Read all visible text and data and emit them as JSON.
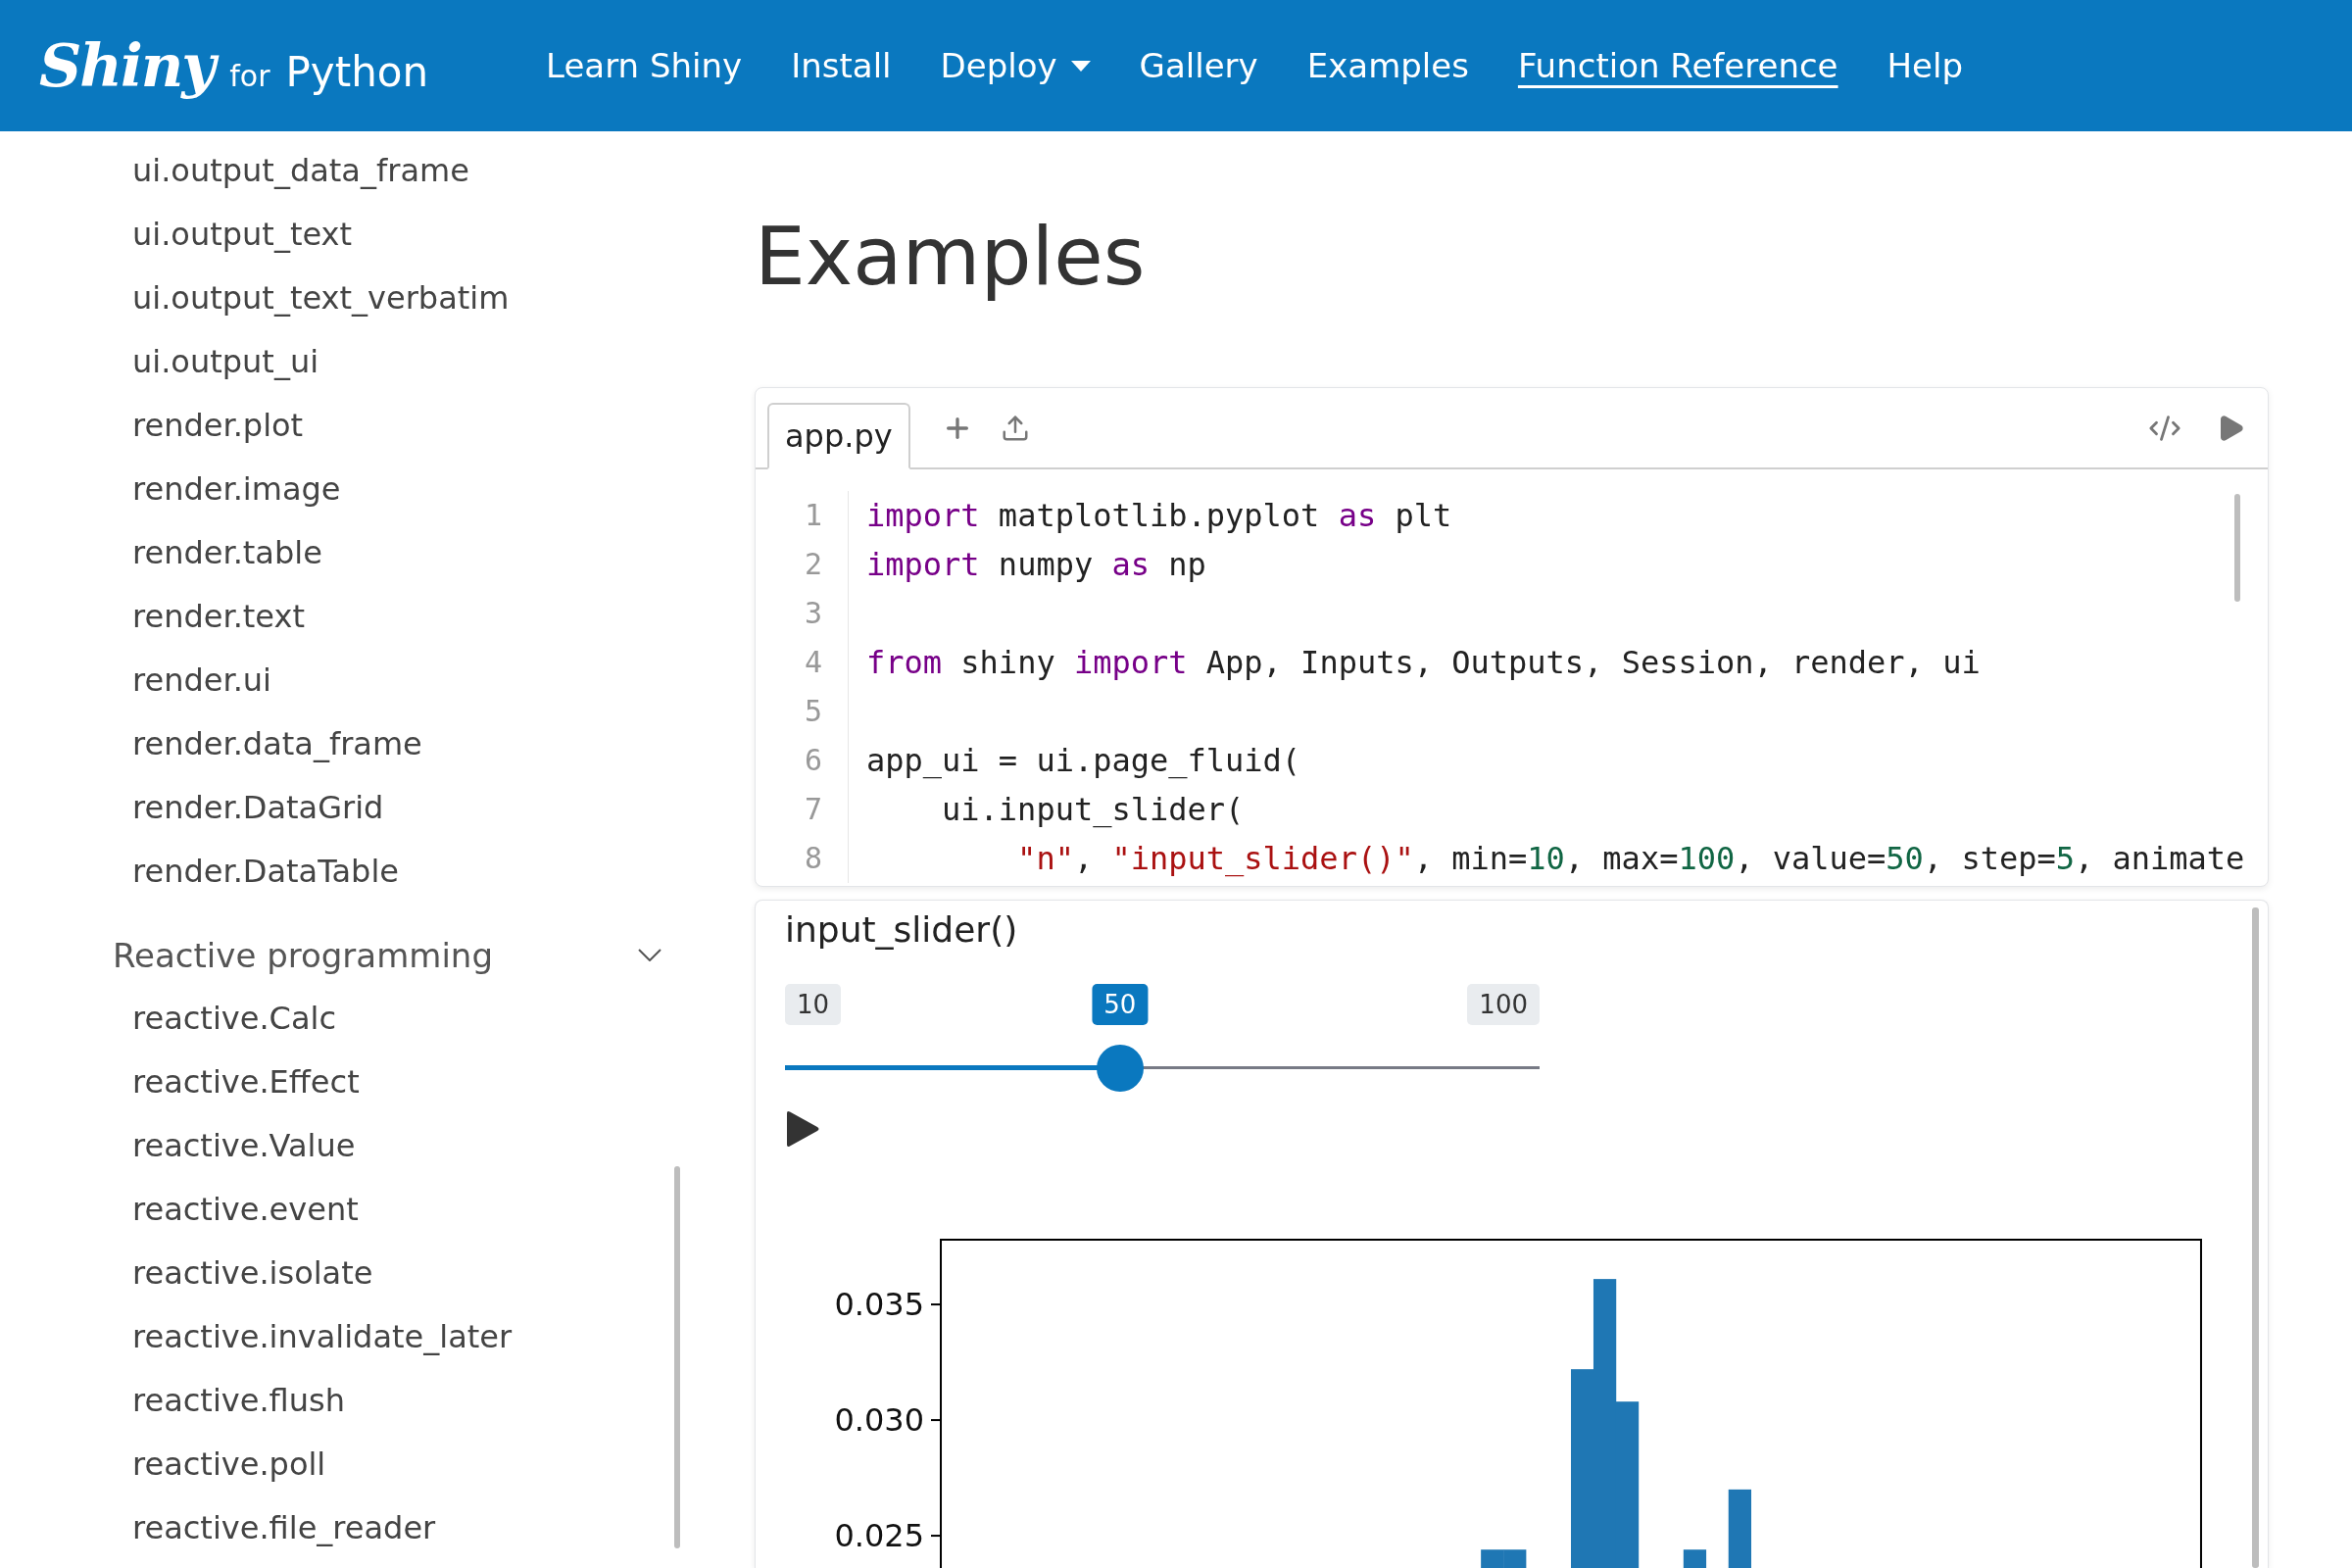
{
  "header": {
    "logo": {
      "brand": "Shiny",
      "small": "for",
      "suffix": "Python"
    },
    "nav": [
      {
        "label": "Learn Shiny",
        "kind": "link",
        "selected": false
      },
      {
        "label": "Install",
        "kind": "link",
        "selected": false
      },
      {
        "label": "Deploy",
        "kind": "dropdown",
        "selected": false
      },
      {
        "label": "Gallery",
        "kind": "link",
        "selected": false
      },
      {
        "label": "Examples",
        "kind": "link",
        "selected": false
      },
      {
        "label": "Function Reference",
        "kind": "link",
        "selected": true
      },
      {
        "label": "Help",
        "kind": "link",
        "selected": false
      }
    ]
  },
  "sidebar": {
    "items": [
      "ui.output_data_frame",
      "ui.output_text",
      "ui.output_text_verbatim",
      "ui.output_ui",
      "render.plot",
      "render.image",
      "render.table",
      "render.text",
      "render.ui",
      "render.data_frame",
      "render.DataGrid",
      "render.DataTable"
    ],
    "sections": [
      {
        "title": "Reactive programming",
        "expanded": true,
        "items": [
          "reactive.Calc",
          "reactive.Effect",
          "reactive.Value",
          "reactive.event",
          "reactive.isolate",
          "reactive.invalidate_later",
          "reactive.flush",
          "reactive.poll",
          "reactive.file_reader"
        ]
      }
    ]
  },
  "page_title": "Examples",
  "editor": {
    "tabs": [
      {
        "label": "app.py",
        "selected": true
      }
    ],
    "lines": [
      {
        "number": "1",
        "tokens": [
          {
            "kind": "keyword",
            "text": "import"
          },
          {
            "kind": "plain",
            "text": " matplotlib.pyplot "
          },
          {
            "kind": "keyword",
            "text": "as"
          },
          {
            "kind": "plain",
            "text": " plt"
          }
        ]
      },
      {
        "number": "2",
        "tokens": [
          {
            "kind": "keyword",
            "text": "import"
          },
          {
            "kind": "plain",
            "text": " numpy "
          },
          {
            "kind": "keyword",
            "text": "as"
          },
          {
            "kind": "plain",
            "text": " np"
          }
        ]
      },
      {
        "number": "3"
      },
      {
        "number": "4",
        "tokens": [
          {
            "kind": "keyword",
            "text": "from"
          },
          {
            "kind": "plain",
            "text": " shiny "
          },
          {
            "kind": "keyword",
            "text": "import"
          },
          {
            "kind": "plain",
            "text": " App, Inputs, Outputs, Session, render, ui"
          }
        ]
      },
      {
        "number": "5"
      },
      {
        "number": "6",
        "tokens": [
          {
            "kind": "plain",
            "text": "app_ui = ui.page_fluid("
          }
        ],
        "children": [
          {
            "number": "7",
            "tokens": [
              {
                "kind": "plain",
                "text": "ui.input_slider("
              }
            ],
            "children": [
              {
                "number": "8",
                "tokens": [
                  {
                    "kind": "string",
                    "text": "\"n\""
                  },
                  {
                    "kind": "plain",
                    "text": ", "
                  },
                  {
                    "kind": "string",
                    "text": "\"input_slider()\""
                  },
                  {
                    "kind": "plain",
                    "text": ", min="
                  },
                  {
                    "kind": "number",
                    "text": "10"
                  },
                  {
                    "kind": "plain",
                    "text": ", max="
                  },
                  {
                    "kind": "number",
                    "text": "100"
                  },
                  {
                    "kind": "plain",
                    "text": ", value="
                  },
                  {
                    "kind": "number",
                    "text": "50"
                  },
                  {
                    "kind": "plain",
                    "text": ", step="
                  },
                  {
                    "kind": "number",
                    "text": "5"
                  },
                  {
                    "kind": "plain",
                    "text": ", animate"
                  }
                ]
              }
            ]
          }
        ]
      }
    ]
  },
  "output": {
    "title": "input_slider()",
    "slider": {
      "min": "10",
      "max": "100",
      "value": "50",
      "level": 0.444
    },
    "chart_data": {
      "type": "bar",
      "series": [
        {
          "color": "#1f77b4",
          "values": [
            null,
            null,
            null,
            null,
            null,
            null,
            null,
            null,
            null,
            null,
            null,
            null,
            null,
            null,
            null,
            null,
            null,
            null,
            null,
            null,
            null,
            null,
            null,
            null,
            0.0244,
            0.0244,
            null,
            null,
            0.0322,
            0.0361,
            0.0308,
            null,
            null,
            0.0244,
            null,
            0.027,
            null,
            null,
            null,
            null,
            null,
            null,
            null,
            null,
            null,
            null,
            null,
            null,
            null,
            null,
            null,
            null,
            null,
            null,
            null,
            null
          ]
        }
      ],
      "ylim": [
        0.0235,
        0.0378
      ],
      "yticks": [
        {
          "value": 0.025,
          "label": "0.025"
        },
        {
          "value": 0.03,
          "label": "0.030"
        },
        {
          "value": 0.035,
          "label": "0.035"
        }
      ]
    }
  }
}
